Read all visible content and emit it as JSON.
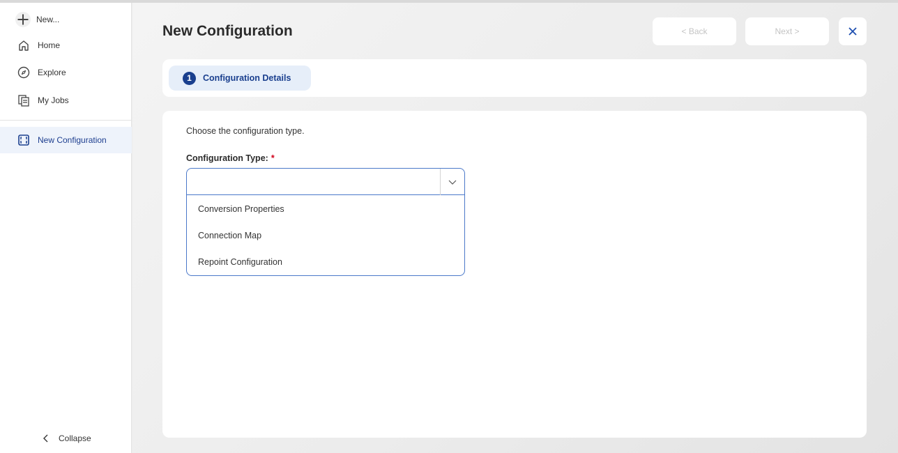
{
  "sidebar": {
    "new_label": "New...",
    "items": [
      {
        "label": "Home",
        "icon": "home-icon"
      },
      {
        "label": "Explore",
        "icon": "compass-icon"
      },
      {
        "label": "My Jobs",
        "icon": "jobs-icon"
      }
    ],
    "active_item": {
      "label": "New Configuration",
      "icon": "configuration-icon"
    },
    "collapse_label": "Collapse"
  },
  "header": {
    "title": "New Configuration",
    "back_label": "< Back",
    "next_label": "Next >",
    "close_icon": "close-icon"
  },
  "steps": [
    {
      "number": "1",
      "label": "Configuration Details"
    }
  ],
  "form": {
    "instruction": "Choose the configuration type.",
    "field_label": "Configuration Type:",
    "required_mark": "*",
    "selected_value": "",
    "options": [
      "Conversion Properties",
      "Connection Map",
      "Repoint Configuration"
    ]
  },
  "colors": {
    "accent": "#1a3f8e",
    "active_bg": "#eef3fb",
    "step_bg": "#e6eef9",
    "required": "#d0021b",
    "select_border": "#4a78c9"
  }
}
